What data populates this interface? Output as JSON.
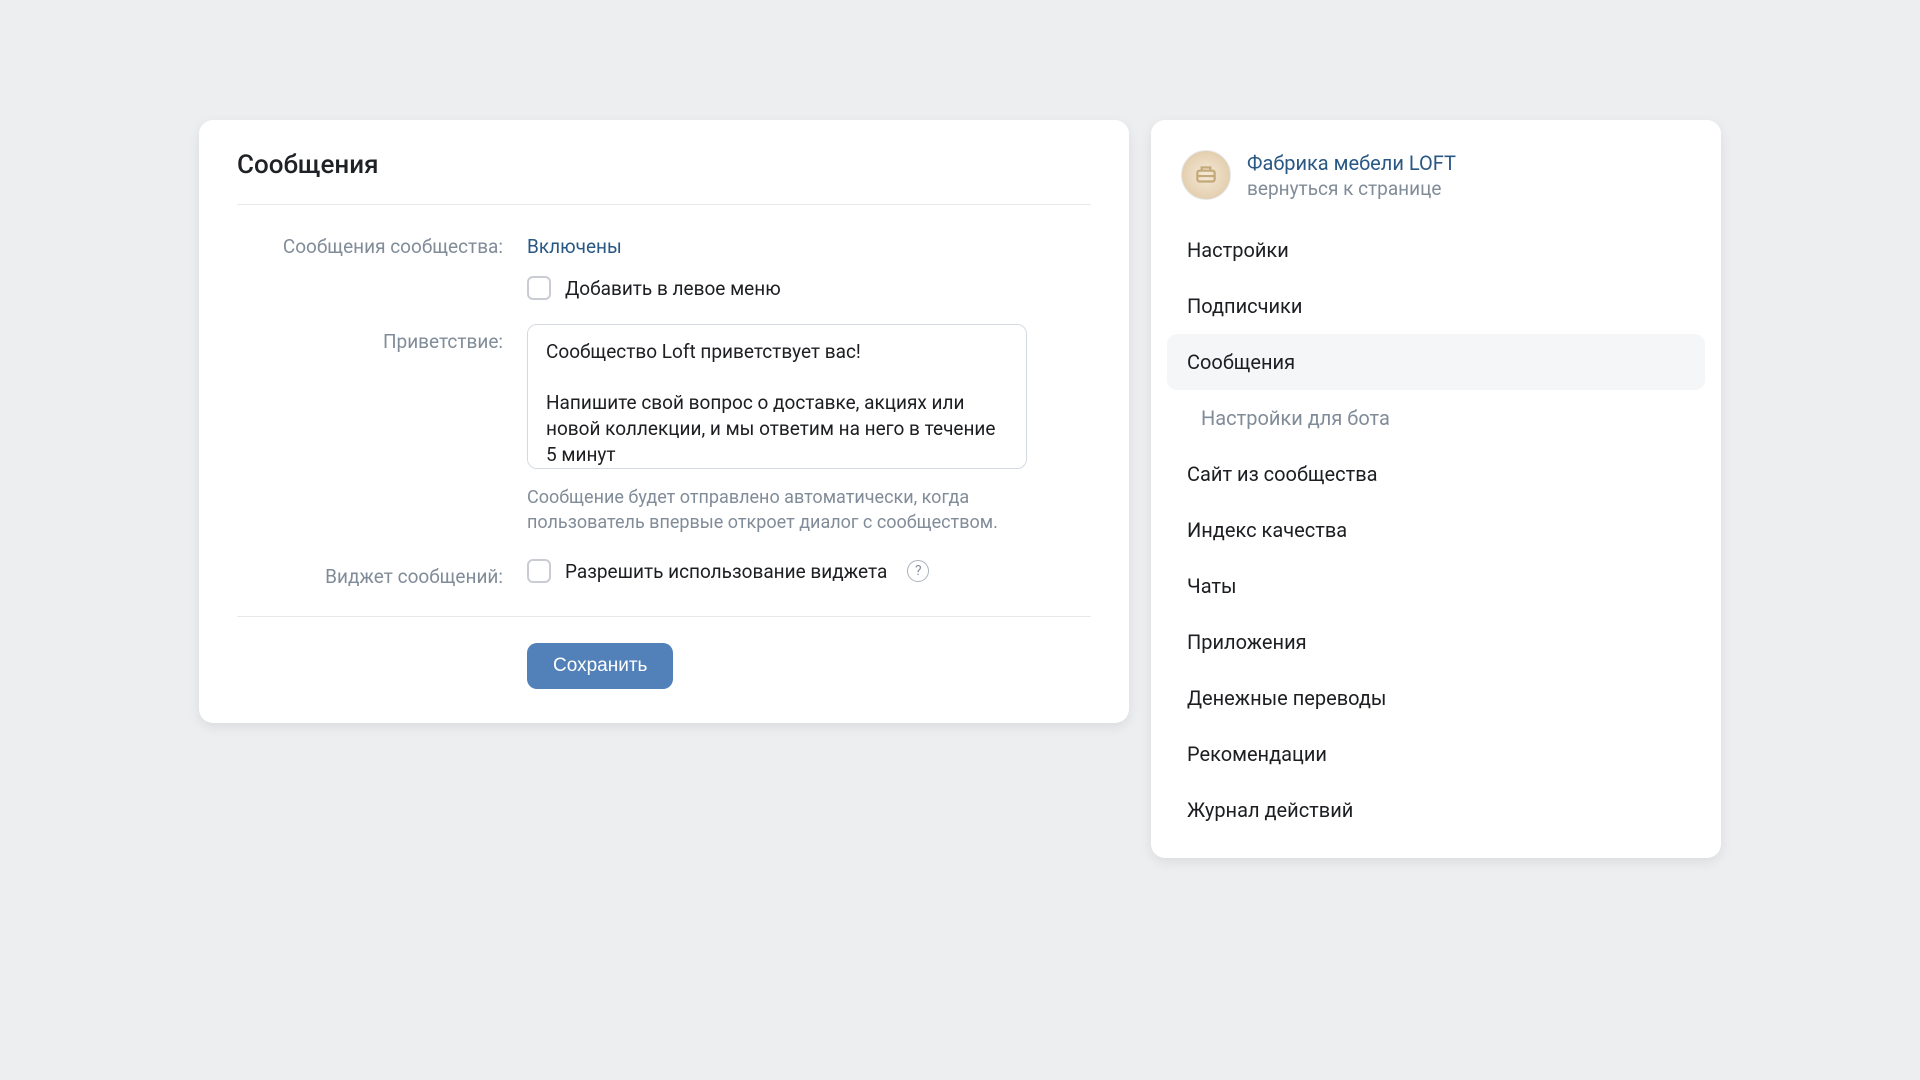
{
  "main": {
    "title": "Сообщения",
    "labels": {
      "community_messages": "Сообщения сообщества:",
      "greeting": "Приветствие:",
      "widget": "Виджет сообщений:"
    },
    "status_enabled": "Включены",
    "add_to_left_menu": "Добавить в левое меню",
    "greeting_text": "Сообщество Loft приветствует вас!\n\nНапишите свой вопрос о доставке, акциях или новой коллекции, и мы ответим на него в течение 5 минут",
    "greeting_hint": "Сообщение будет отправлено автоматически, когда пользователь впервые откроет диалог с сообществом.",
    "allow_widget": "Разрешить использование виджета",
    "save": "Сохранить",
    "help_glyph": "?"
  },
  "sidebar": {
    "community_name": "Фабрика мебели LOFT",
    "back_link": "вернуться к странице",
    "items": [
      {
        "label": "Настройки",
        "active": false
      },
      {
        "label": "Подписчики",
        "active": false
      },
      {
        "label": "Сообщения",
        "active": true
      },
      {
        "label": "Настройки для бота",
        "active": false,
        "sub": true
      },
      {
        "label": "Сайт из сообщества",
        "active": false
      },
      {
        "label": "Индекс качества",
        "active": false
      },
      {
        "label": "Чаты",
        "active": false
      },
      {
        "label": "Приложения",
        "active": false
      },
      {
        "label": "Денежные переводы",
        "active": false
      },
      {
        "label": "Рекомендации",
        "active": false
      },
      {
        "label": "Журнал действий",
        "active": false
      }
    ]
  }
}
